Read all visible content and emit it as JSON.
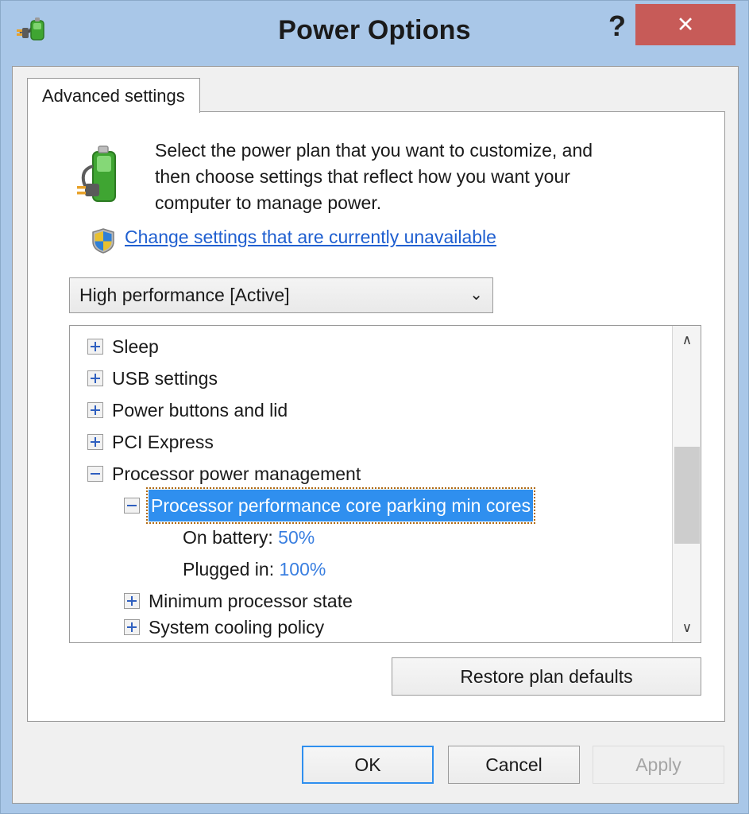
{
  "window": {
    "title": "Power Options",
    "icon": "power-plug-battery-icon",
    "help_label": "?",
    "close_label": "✕",
    "border_color": "#a9c7e8",
    "close_color": "#c75b58"
  },
  "tabs": [
    {
      "label": "Advanced settings",
      "active": true
    }
  ],
  "intro": {
    "icon": "battery-plug-icon",
    "line1": "Select the power plan that you want to customize, and",
    "line2": "then choose settings that reflect how you want your",
    "line3": "computer to manage power."
  },
  "uac": {
    "icon": "uac-shield-icon",
    "link_label": "Change settings that are currently unavailable",
    "link_color": "#1f5fd0"
  },
  "plan_select": {
    "value": "High performance [Active]",
    "chevron": "⌄",
    "options": [
      "High performance [Active]"
    ]
  },
  "tree": {
    "selection_color": "#2f8fef",
    "value_color": "#3a7fe0",
    "rows": [
      {
        "level": 0,
        "expander": "plus",
        "label": "Sleep"
      },
      {
        "level": 0,
        "expander": "plus",
        "label": "USB settings"
      },
      {
        "level": 0,
        "expander": "plus",
        "label": "Power buttons and lid"
      },
      {
        "level": 0,
        "expander": "plus",
        "label": "PCI Express"
      },
      {
        "level": 0,
        "expander": "minus",
        "label": "Processor power management"
      },
      {
        "level": 1,
        "expander": "minus",
        "label": "Processor performance core parking min cores",
        "selected": true
      },
      {
        "level": 2,
        "expander": "none",
        "label": "On battery:",
        "value": "50%"
      },
      {
        "level": 2,
        "expander": "none",
        "label": "Plugged in:",
        "value": "100%"
      },
      {
        "level": 1,
        "expander": "plus",
        "label": "Minimum processor state"
      },
      {
        "level": 1,
        "expander": "plus",
        "label": "System cooling policy",
        "clipped": true
      }
    ]
  },
  "scrollbar": {
    "up_arrow": "∧",
    "down_arrow": "∨"
  },
  "restore": {
    "label": "Restore plan defaults"
  },
  "footer": {
    "ok_label": "OK",
    "cancel_label": "Cancel",
    "apply_label": "Apply",
    "apply_enabled": false
  }
}
